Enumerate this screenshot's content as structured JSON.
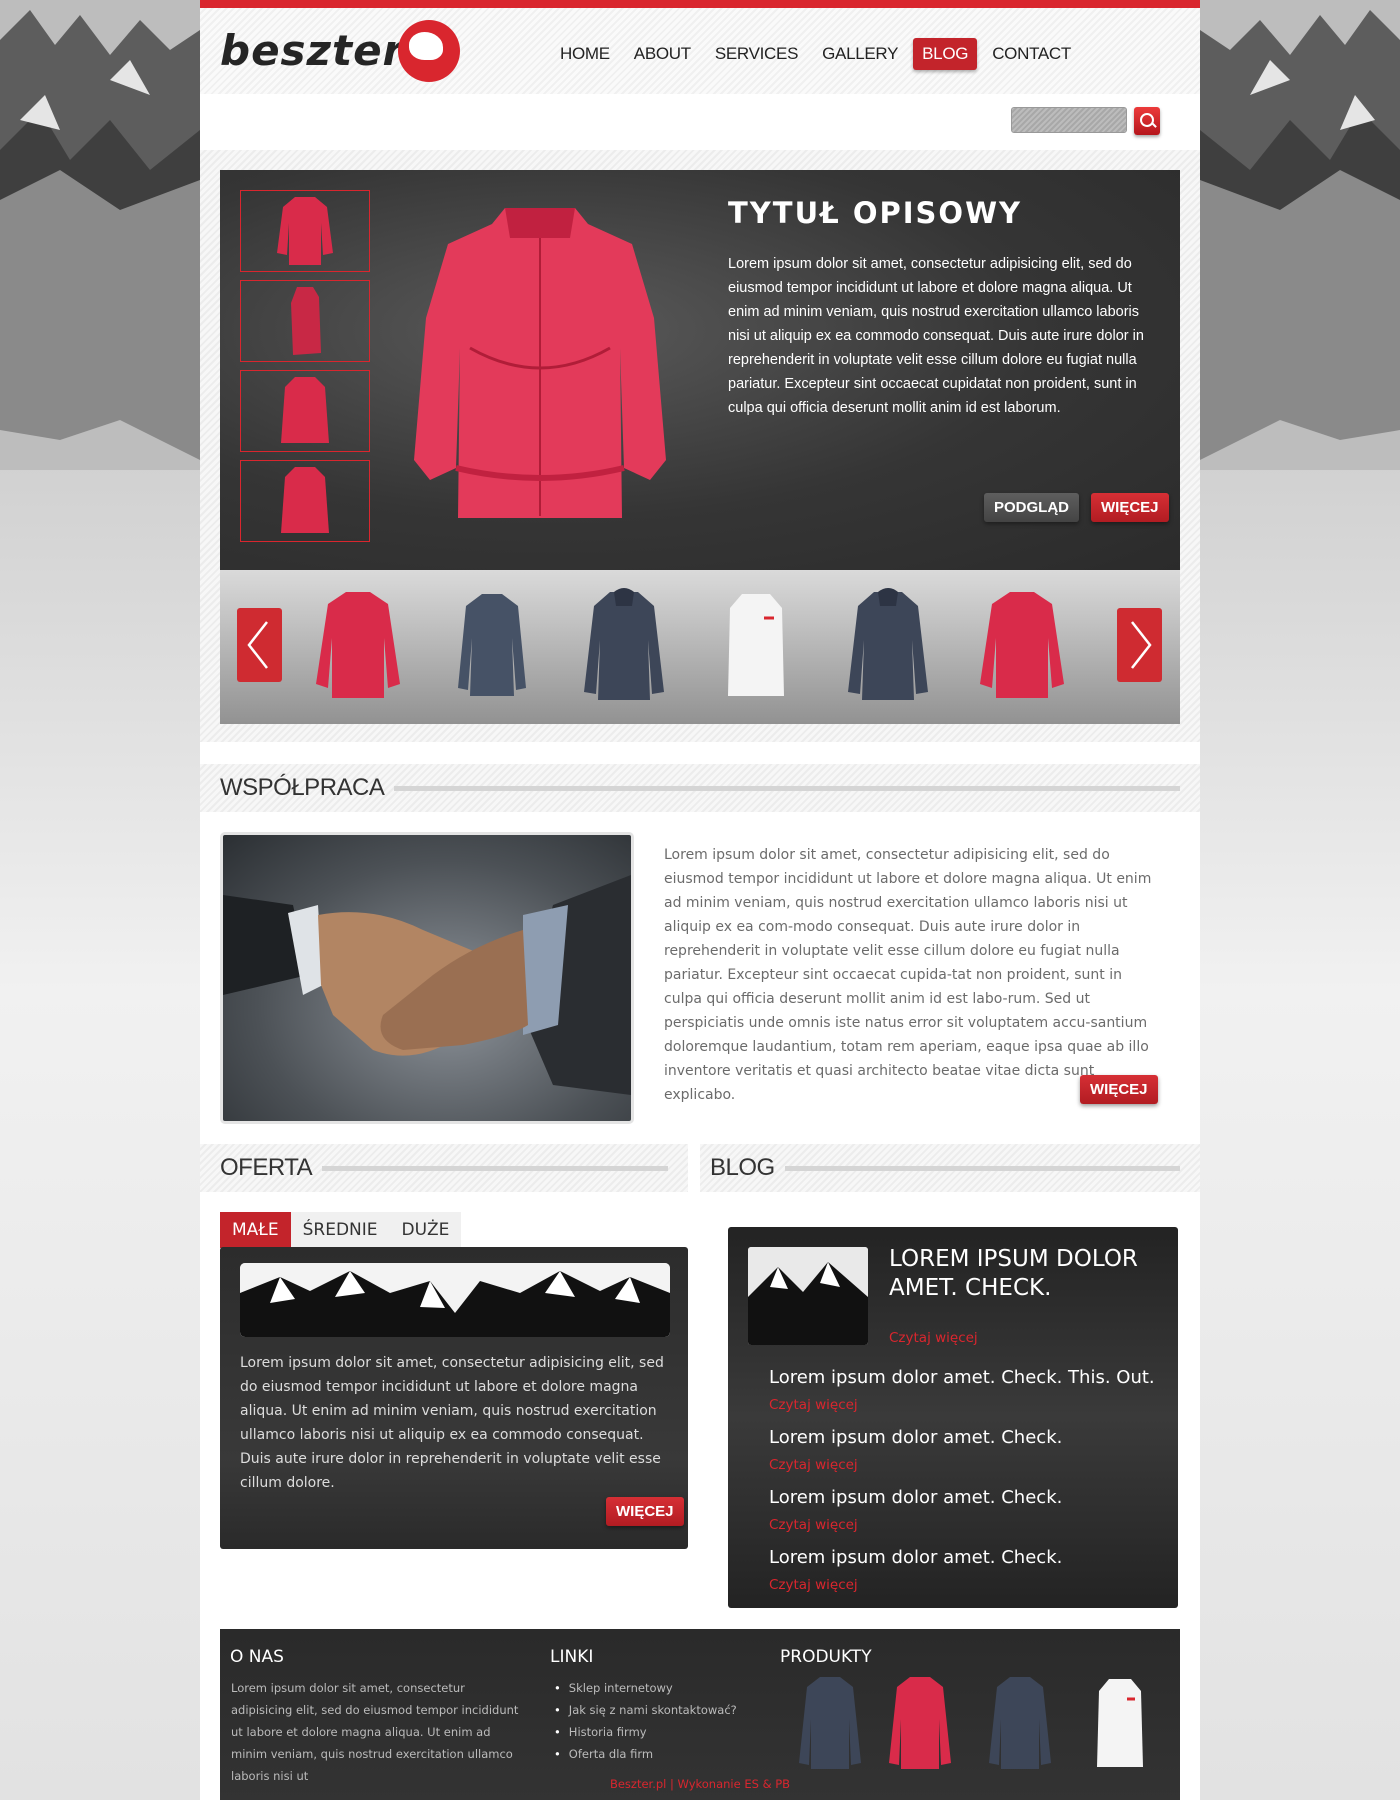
{
  "brand": {
    "name": "beszter",
    "accent": "#d9262e",
    "dark": "#2b2b2b"
  },
  "nav": {
    "items": [
      "HOME",
      "ABOUT",
      "SERVICES",
      "GALLERY",
      "BLOG",
      "CONTACT"
    ],
    "active": "BLOG"
  },
  "search": {
    "placeholder": "",
    "icon": "search-icon"
  },
  "feature": {
    "title": "TYTUŁ OPISOWY",
    "text": "Lorem ipsum dolor sit amet, consectetur adipisicing elit, sed do eiusmod tempor incididunt ut labore et dolore magna aliqua. Ut enim ad minim veniam, quis nostrud exercitation ullamco laboris nisi ut aliquip ex ea commodo consequat. Duis aute irure dolor in reprehenderit in voluptate velit esse cillum dolore eu fugiat nulla pariatur. Excepteur sint occaecat cupidatat non proident, sunt in culpa qui officia deserunt mollit anim id est laborum.",
    "preview_label": "PODGLĄD",
    "more_label": "WIĘCEJ"
  },
  "carousel": {
    "prev_icon": "chevron-left-icon",
    "next_icon": "chevron-right-icon"
  },
  "cooperation": {
    "heading": "WSPÓŁPRACA",
    "text": "Lorem ipsum dolor sit amet, consectetur adipisicing elit, sed do eiusmod tempor incididunt ut labore et dolore magna aliqua. Ut enim ad minim veniam, quis nostrud exercitation ullamco laboris nisi ut aliquip ex ea com-modo consequat. Duis aute irure dolor in reprehenderit in voluptate velit esse cillum dolore eu fugiat nulla pariatur. Excepteur sint occaecat cupida-tat non proident, sunt in culpa qui officia deserunt mollit anim id est labo-rum. Sed ut perspiciatis unde omnis iste natus error sit voluptatem accu-santium doloremque laudantium, totam rem aperiam, eaque ipsa quae ab illo inventore veritatis et quasi architecto beatae vitae dicta sunt explicabo.",
    "more_label": "WIĘCEJ"
  },
  "offer": {
    "heading": "OFERTA",
    "tabs": [
      "MAŁE",
      "ŚREDNIE",
      "DUŻE"
    ],
    "active_tab": "MAŁE",
    "text": "Lorem ipsum dolor sit amet, consectetur adipisicing elit, sed do eiusmod tempor incididunt ut labore et dolore magna aliqua. Ut enim ad minim veniam, quis nostrud exercitation ullamco laboris nisi ut aliquip ex ea commodo consequat. Duis aute irure dolor in reprehenderit in voluptate velit esse cillum dolore.",
    "more_label": "WIĘCEJ"
  },
  "blog": {
    "heading": "BLOG",
    "featured_title": "LOREM IPSUM DOLOR AMET. CHECK.",
    "read_more": "Czytaj więcej",
    "items": [
      "Lorem ipsum dolor amet. Check. This. Out.",
      "Lorem ipsum dolor amet. Check.",
      "Lorem ipsum dolor amet. Check.",
      "Lorem ipsum dolor amet. Check."
    ]
  },
  "footer": {
    "about_heading": "O NAS",
    "about_text": "Lorem ipsum dolor sit amet, consectetur adipisicing elit, sed do eiusmod tempor incididunt ut labore et dolore magna aliqua. Ut enim ad minim veniam, quis nostrud exercitation ullamco laboris nisi ut",
    "links_heading": "LINKI",
    "links": [
      "Sklep internetowy",
      "Jak się z nami skontaktować?",
      "Historia firmy",
      "Oferta dla firm"
    ],
    "products_heading": "PRODUKTY",
    "copyright": "Beszter.pl | Wykonanie ES & PB"
  }
}
